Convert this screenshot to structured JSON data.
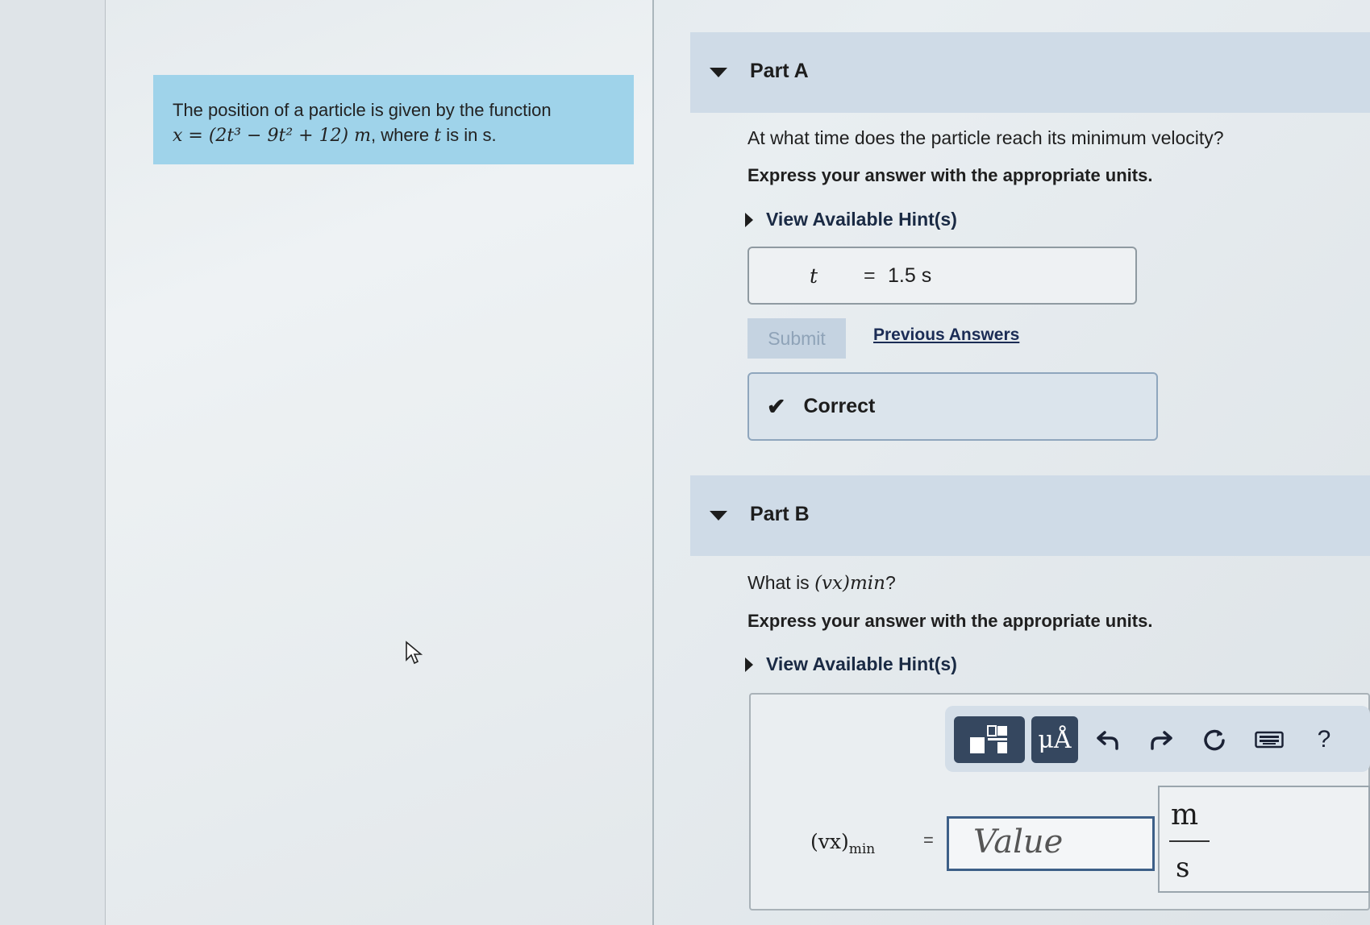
{
  "problem": {
    "text_1": "The position of a particle is given by the function",
    "formula": "x = (2t³ − 9t² + 12) m",
    "text_2": ", where ",
    "var_t": "t",
    "text_3": " is in s."
  },
  "part_a": {
    "title": "Part A",
    "question": "At what time does the particle reach its minimum velocity?",
    "instruction": "Express your answer with the appropriate units.",
    "hint_label": "View Available Hint(s)",
    "answer_var": "t",
    "answer_eq": "=",
    "answer_value": "1.5 s",
    "submit_label": "Submit",
    "previous_answers_label": "Previous Answers",
    "feedback_label": "Correct"
  },
  "part_b": {
    "title": "Part B",
    "question_prefix": "What is ",
    "question_math": "(vx)min",
    "question_suffix": "?",
    "instruction": "Express your answer with the appropriate units.",
    "hint_label": "View Available Hint(s)",
    "toolbar": {
      "units_label": "μÅ",
      "help_label": "?"
    },
    "formula_label": "(vx)",
    "formula_sub": "min",
    "formula_eq": "=",
    "value_placeholder": "Value",
    "unit_numerator": "m",
    "unit_denominator": "s"
  }
}
